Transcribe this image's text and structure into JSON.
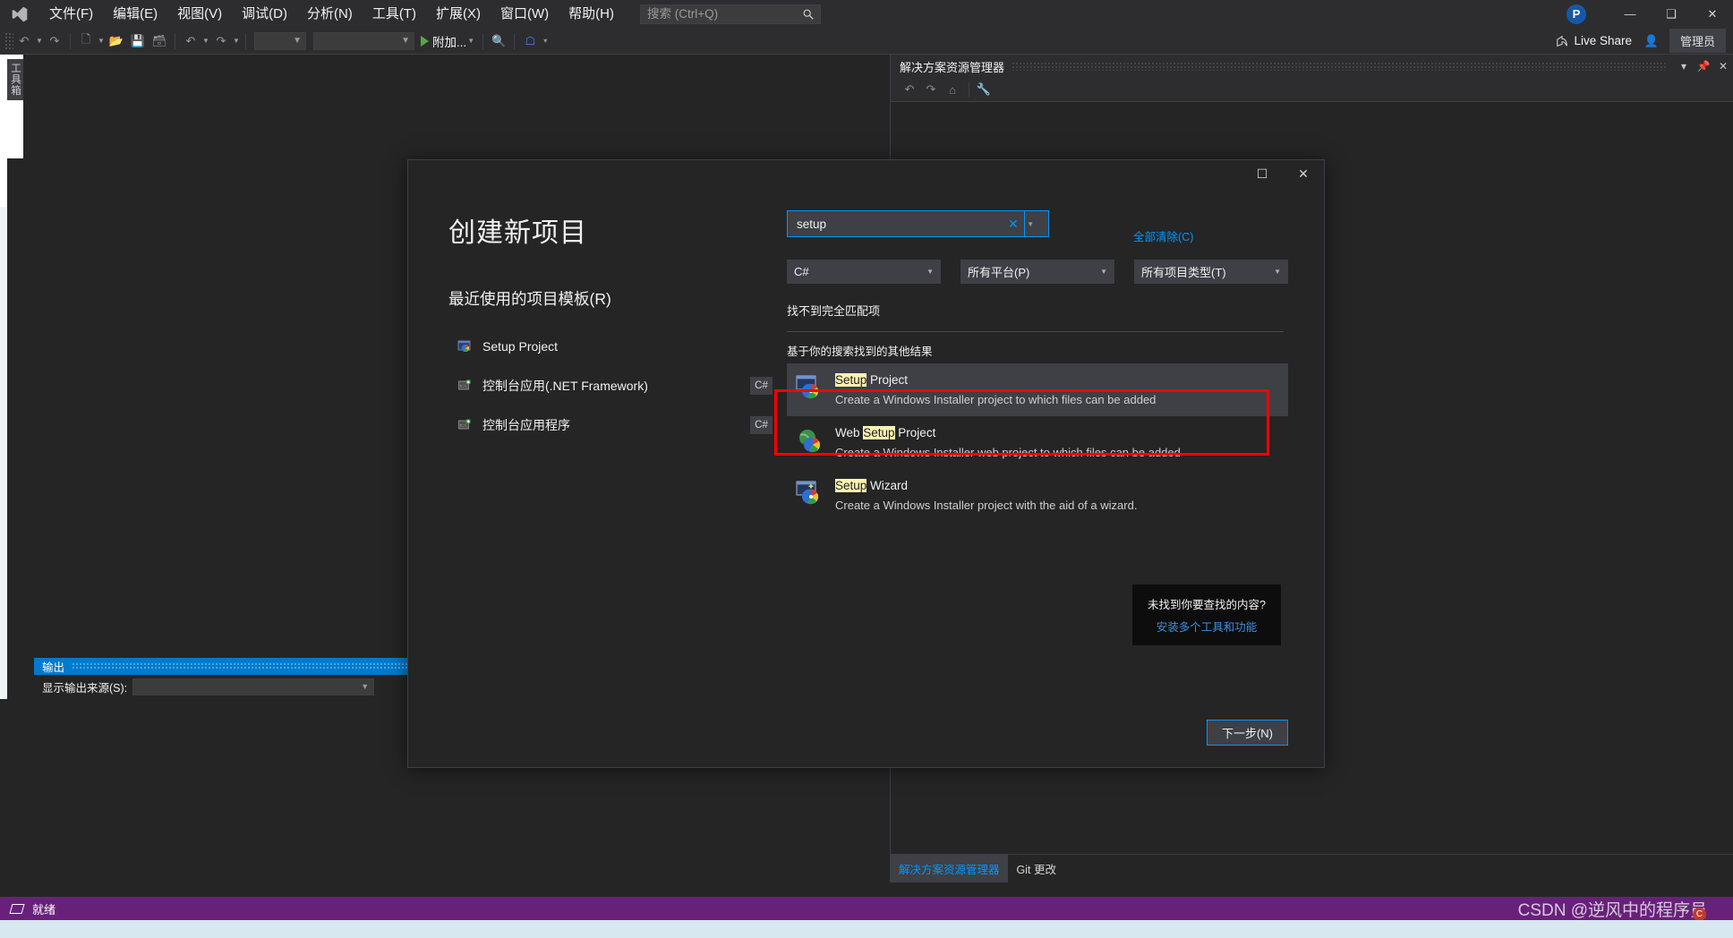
{
  "app": {
    "menu": [
      {
        "label": "文件(F)"
      },
      {
        "label": "编辑(E)"
      },
      {
        "label": "视图(V)"
      },
      {
        "label": "调试(D)"
      },
      {
        "label": "分析(N)"
      },
      {
        "label": "工具(T)"
      },
      {
        "label": "扩展(X)"
      },
      {
        "label": "窗口(W)"
      },
      {
        "label": "帮助(H)"
      }
    ],
    "quick_search_placeholder": "搜索 (Ctrl+Q)",
    "quick_search_value": "",
    "avatar_initial": "P",
    "live_share_label": "Live Share",
    "account_label": "管理员",
    "toolbar": {
      "attach_label": "附加...",
      "combo1_value": "",
      "combo2_value": ""
    },
    "toolbox_tab_label": "工具箱"
  },
  "solution_explorer": {
    "title": "解决方案资源管理器",
    "tabs": [
      {
        "label": "解决方案资源管理器",
        "active": true
      },
      {
        "label": "Git 更改",
        "active": false
      }
    ]
  },
  "output_panel": {
    "title": "输出",
    "source_label": "显示输出来源(S):",
    "source_value": ""
  },
  "status_bar": {
    "text": "就绪",
    "watermark": "CSDN @逆风中的程序员"
  },
  "dialog": {
    "title": "创建新项目",
    "recent_heading": "最近使用的项目模板(R)",
    "recent_templates": [
      {
        "label": "Setup Project",
        "badge": "",
        "icon": "setup-project-icon"
      },
      {
        "label": "控制台应用(.NET Framework)",
        "badge": "C#",
        "icon": "console-app-icon"
      },
      {
        "label": "控制台应用程序",
        "badge": "C#",
        "icon": "console-app-icon"
      }
    ],
    "search": {
      "value": "setup",
      "clear_icon": "clear-icon",
      "dropdown_icon": "chevron-down-icon"
    },
    "clear_all_label": "全部清除(C)",
    "clear_all_accel": "C",
    "filters": [
      {
        "name": "language",
        "value": "C#",
        "accel": ""
      },
      {
        "name": "platform",
        "value": "所有平台(P)",
        "accel": "P"
      },
      {
        "name": "project-type",
        "value": "所有项目类型(T)",
        "accel": "T"
      }
    ],
    "no_exact_match": "找不到完全匹配项",
    "other_results_heading": "基于你的搜索找到的其他结果",
    "results": [
      {
        "title_pre": "",
        "title_hl": "Setup",
        "title_post": " Project",
        "description": "Create a Windows Installer project to which files can be added",
        "selected": true,
        "icon": "setup-project-icon"
      },
      {
        "title_pre": "Web ",
        "title_hl": "Setup",
        "title_post": " Project",
        "description": "Create a Windows Installer web project to which files can be added",
        "selected": false,
        "icon": "web-setup-project-icon"
      },
      {
        "title_pre": "",
        "title_hl": "Setup",
        "title_post": " Wizard",
        "description": "Create a Windows Installer project with the aid of a wizard.",
        "selected": false,
        "icon": "setup-wizard-icon"
      }
    ],
    "tooltip": {
      "question": "未找到你要查找的内容?",
      "link": "安装多个工具和功能"
    },
    "next_button": "下一步(N)",
    "next_button_accel": "N"
  },
  "colors": {
    "accent": "#0097fb",
    "status_bar": "#68217a",
    "output_header": "#007acc",
    "highlight": "#fff3b0",
    "red_outline": "#ff0000"
  }
}
